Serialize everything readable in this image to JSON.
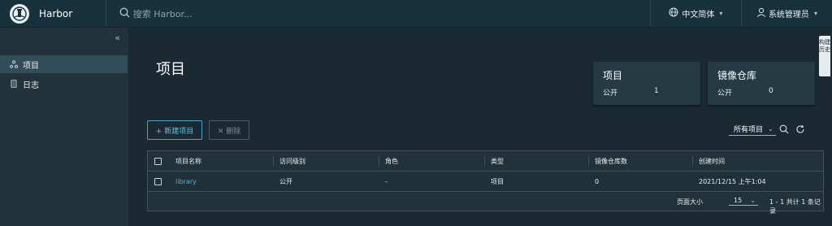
{
  "app": {
    "title": "Harbor"
  },
  "header": {
    "search_placeholder": "搜索 Harbor...",
    "language": "中文简体",
    "user": "系统管理员"
  },
  "sidebar": {
    "items": [
      {
        "label": "项目",
        "icon": "projects-icon",
        "active": true
      },
      {
        "label": "日志",
        "icon": "logs-icon",
        "active": false
      }
    ]
  },
  "main": {
    "title": "项目",
    "cards": [
      {
        "title": "项目",
        "label": "公开",
        "value": "1"
      },
      {
        "title": "镜像仓库",
        "label": "公开",
        "value": "0"
      }
    ],
    "side_tab": "构建历史",
    "toolbar": {
      "new_label": "+ 新建项目",
      "delete_label": "✕ 删除",
      "filter_value": "所有项目"
    },
    "table": {
      "columns": [
        "项目名称",
        "访问级别",
        "角色",
        "类型",
        "镜像仓库数",
        "创建时间"
      ],
      "rows": [
        [
          "library",
          "公开",
          "-",
          "项目",
          "0",
          "2021/12/15 上午1:04"
        ]
      ],
      "page_size_label": "页面大小",
      "page_size": "15",
      "total": "1 - 1 共计 1 条记录"
    }
  },
  "colors": {
    "header_bg": "#17313d",
    "sidebar_bg": "#21323a",
    "content_bg": "#1b2a32",
    "accent": "#4fb3e0"
  }
}
